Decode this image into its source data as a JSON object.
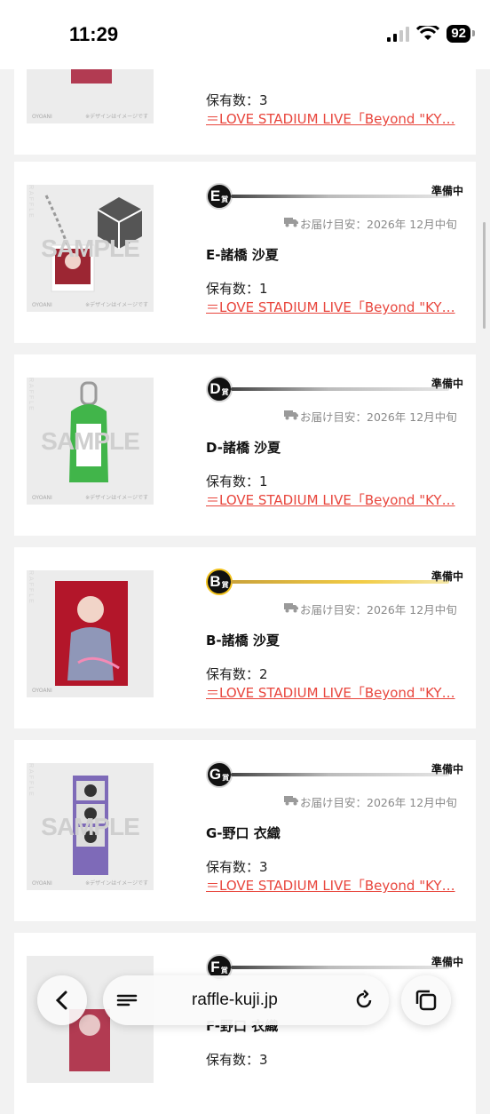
{
  "status_bar": {
    "time": "11:29",
    "battery": "92"
  },
  "common": {
    "image_notice": "※デザインはイメージです",
    "image_brand": "OYOANI",
    "watermark": "RAFFLE",
    "sample": "SAMPLE"
  },
  "items": [
    {
      "badge": "",
      "status": "",
      "delivery": "",
      "name": "",
      "quantity": "保有数：3",
      "event_link": "＝LOVE STADIUM LIVE「Beyond \"KY…"
    },
    {
      "badge": "E",
      "badge_suffix": "賞",
      "status": "準備中",
      "delivery": "お届け目安：2026年 12月中旬",
      "name": "E-諸橋 沙夏",
      "quantity": "保有数：1",
      "event_link": "＝LOVE STADIUM LIVE「Beyond \"KY…"
    },
    {
      "badge": "D",
      "badge_suffix": "賞",
      "status": "準備中",
      "delivery": "お届け目安：2026年 12月中旬",
      "name": "D-諸橋 沙夏",
      "quantity": "保有数：1",
      "event_link": "＝LOVE STADIUM LIVE「Beyond \"KY…"
    },
    {
      "badge": "B",
      "badge_suffix": "賞",
      "status": "準備中",
      "delivery": "お届け目安：2026年 12月中旬",
      "name": "B-諸橋 沙夏",
      "quantity": "保有数：2",
      "event_link": "＝LOVE STADIUM LIVE「Beyond \"KY…",
      "accent": "#f2c21b"
    },
    {
      "badge": "G",
      "badge_suffix": "賞",
      "status": "準備中",
      "delivery": "お届け目安：2026年 12月中旬",
      "name": "G-野口 衣織",
      "quantity": "保有数：3",
      "event_link": "＝LOVE STADIUM LIVE「Beyond \"KY…"
    },
    {
      "badge": "F",
      "badge_suffix": "賞",
      "status": "準備中",
      "delivery": "",
      "name": "F-野口 衣織",
      "quantity": "保有数：3",
      "event_link": ""
    }
  ],
  "browser": {
    "url": "raffle-kuji.jp"
  },
  "colors": {
    "link": "#e8453c",
    "gold": "#f2c21b"
  }
}
